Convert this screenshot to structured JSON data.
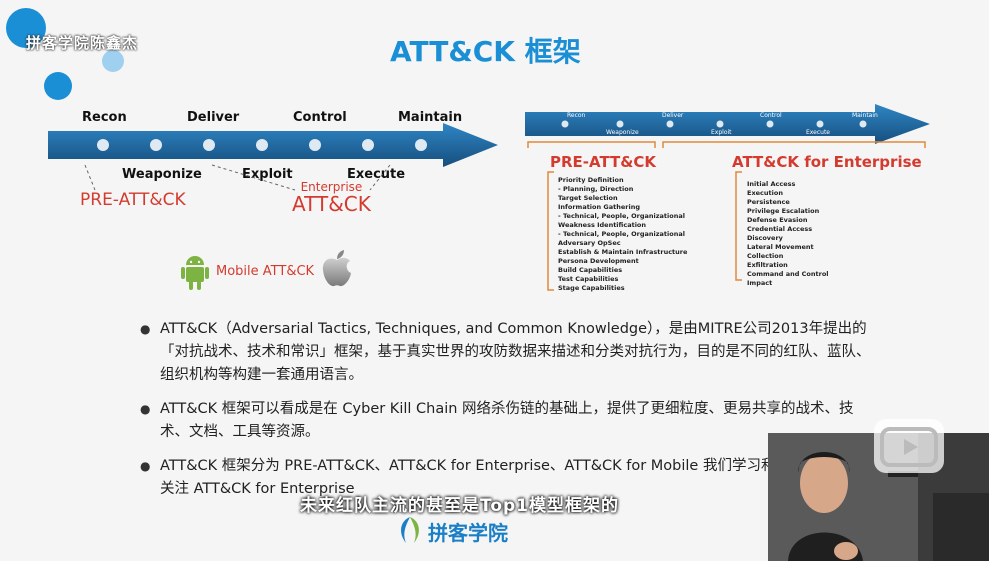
{
  "watermark": "拼客学院陈鑫杰",
  "title": "ATT&CK 框架",
  "left_diagram": {
    "top_labels": [
      "Recon",
      "Deliver",
      "Control",
      "Maintain"
    ],
    "bottom_labels": [
      "Weaponize",
      "Exploit",
      "Execute"
    ],
    "pre_attack": "PRE-ATT&CK",
    "enterprise_small": "Enterprise",
    "enterprise_big": "ATT&CK",
    "mobile": "Mobile ATT&CK"
  },
  "right_diagram": {
    "top_labels": [
      "Recon",
      "Deliver",
      "Control",
      "Maintain"
    ],
    "bottom_labels": [
      "Weaponize",
      "Exploit",
      "Execute"
    ],
    "pre_title": "PRE-ATT&CK",
    "pre_items": [
      "Priority Definition",
      "-    Planning, Direction",
      "Target Selection",
      "Information Gathering",
      "-    Technical, People, Organizational",
      "Weakness Identification",
      "-    Technical, People, Organizational",
      "Adversary OpSec",
      "Establish & Maintain Infrastructure",
      "Persona Development",
      "Build Capabilities",
      "Test Capabilities",
      "Stage Capabilities"
    ],
    "ent_title": "ATT&CK for Enterprise",
    "ent_items": [
      "Initial Access",
      "Execution",
      "Persistence",
      "Privilege Escalation",
      "Defense Evasion",
      "Credential Access",
      "Discovery",
      "Lateral Movement",
      "Collection",
      "Exfiltration",
      "Command and Control",
      "Impact"
    ]
  },
  "bullets": [
    "ATT&CK（Adversarial Tactics, Techniques, and Common Knowledge），是由MITRE公司2013年提出的「对抗战术、技术和常识」框架，基于真实世界的攻防数据来描述和分类对抗行为，目的是不同的红队、蓝队、组织机构等构建一套通用语言。",
    "ATT&CK 框架可以看成是在 Cyber Kill Chain 网络杀伤链的基础上，提供了更细粒度、更易共享的战术、技术、文档、工具等资源。",
    "ATT&CK 框架分为 PRE-ATT&CK、ATT&CK for Enterprise、ATT&CK for Mobile 我们学习和讨论，一般重点关注 ATT&CK for Enterprise"
  ],
  "subtitle": "未来红队主流的甚至是Top1模型框架的",
  "brand": "拼客学院",
  "colors": {
    "title": "#1b8fd6",
    "arrow": "#1f6fa8",
    "accent_red": "#d43b2f"
  }
}
